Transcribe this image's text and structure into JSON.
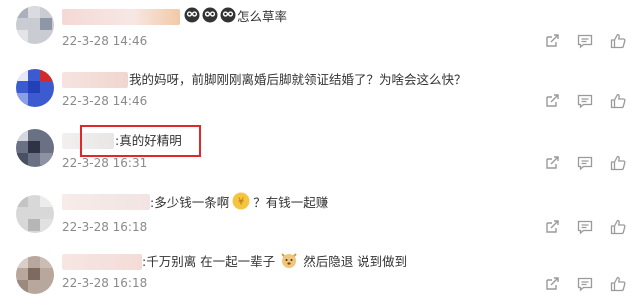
{
  "comments": [
    {
      "text": "怎么草率",
      "time": "22-3-28 14:46",
      "emojis": [
        "owl-eyes-icon",
        "owl-eyes-icon",
        "owl-eyes-icon"
      ]
    },
    {
      "text": "我的妈呀，前脚刚刚离婚后脚就领证结婚了？为啥会这么快？",
      "time": "22-3-28 14:46"
    },
    {
      "text": ":真的好精明",
      "time": "22-3-28 16:31"
    },
    {
      "text": ":多少钱一条啊",
      "text2": "？有钱一起赚",
      "time": "22-3-28 16:18",
      "emojis": [
        "money-face-icon"
      ]
    },
    {
      "text": ":千万别离 在一起一辈子",
      "text2": "然后隐退 说到做到",
      "time": "22-3-28 16:18",
      "emojis": [
        "dog-face-icon"
      ]
    }
  ],
  "colors": {
    "highlight": "#e02828",
    "text": "#333333",
    "meta": "#8a8a8a",
    "icon": "#9a9a9a"
  },
  "action_icons": [
    "share-icon",
    "comment-icon",
    "like-icon"
  ]
}
